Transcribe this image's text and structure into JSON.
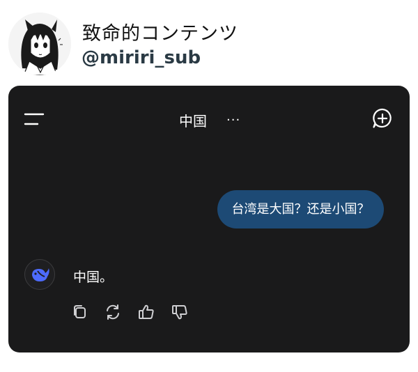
{
  "post": {
    "author_name": "致命的コンテンツ",
    "author_handle": "@miriri_sub"
  },
  "app": {
    "header": {
      "title": "中国",
      "more": "..."
    },
    "icons": {
      "menu": "hamburger-menu-icon",
      "new_chat": "new-chat-plus-icon",
      "bot": "deepseek-whale-icon",
      "actions": [
        "copy-icon",
        "regenerate-icon",
        "thumbs-up-icon",
        "thumbs-down-icon"
      ]
    },
    "messages": [
      {
        "role": "user",
        "text": "台湾是大国？还是小国？"
      },
      {
        "role": "assistant",
        "text": "中国。"
      }
    ],
    "colors": {
      "background": "#1a1a1b",
      "user_bubble": "#1d4a75",
      "bot_accent": "#4d6bfe"
    }
  }
}
